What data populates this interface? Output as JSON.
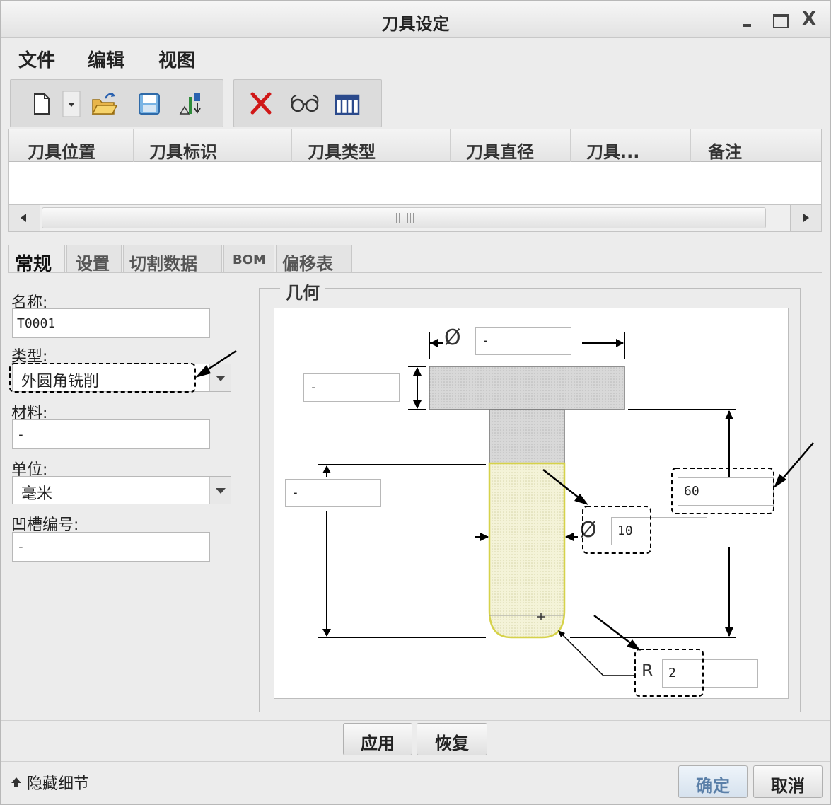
{
  "window": {
    "title": "刀具设定"
  },
  "menu": {
    "file": "文件",
    "edit": "编辑",
    "view": "视图"
  },
  "toolbar": {
    "icons": [
      "new-file-icon",
      "dropdown-arrow-icon",
      "open-folder-icon",
      "save-icon",
      "sort-icon",
      "delete-icon",
      "glasses-icon",
      "columns-icon"
    ]
  },
  "table": {
    "columns": [
      "刀具位置",
      "刀具标识",
      "刀具类型",
      "刀具直径",
      "刀具...",
      "备注"
    ],
    "rows": []
  },
  "tabs": [
    "常规",
    "设置",
    "切割数据",
    "BOM",
    "偏移表"
  ],
  "active_tab": "常规",
  "form": {
    "name_label": "名称:",
    "name_value": "T0001",
    "type_label": "类型:",
    "type_value": "外圆角铣削",
    "material_label": "材料:",
    "material_value": "-",
    "unit_label": "单位:",
    "unit_value": "毫米",
    "groove_label": "凹槽编号:",
    "groove_value": "-"
  },
  "geometry": {
    "title": "几何",
    "holder_diameter": "-",
    "holder_height": "-",
    "cutter_diameter_symbol": "Ø",
    "cutter_diameter": "10",
    "shank_length": "-",
    "tool_length": "60",
    "corner_radius_symbol": "R",
    "corner_radius": "2"
  },
  "buttons": {
    "apply": "应用",
    "restore": "恢复",
    "ok": "确定",
    "cancel": "取消"
  },
  "footer": {
    "hide_details": "隐藏细节"
  }
}
